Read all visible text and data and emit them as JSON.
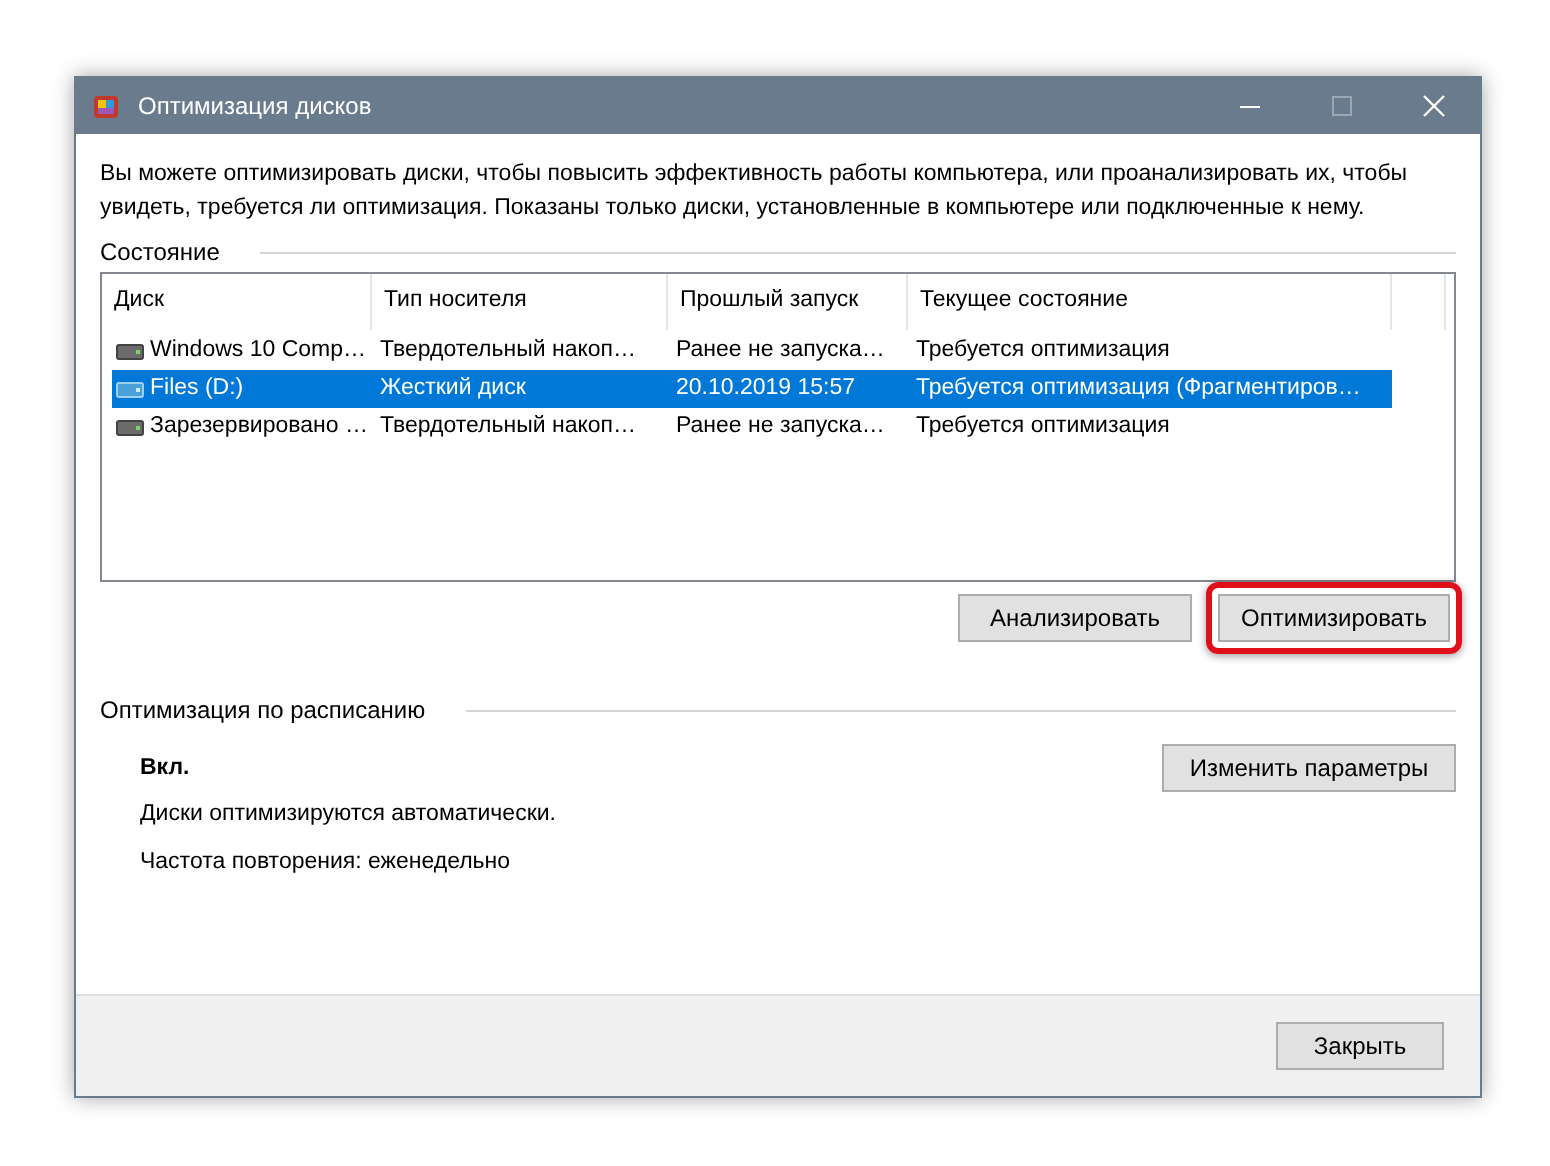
{
  "window": {
    "title": "Оптимизация дисков"
  },
  "description": "Вы можете оптимизировать диски, чтобы повысить эффективность работы  компьютера, или проанализировать их, чтобы увидеть, требуется ли оптимизация. Показаны только диски, установленные в компьютере или подключенные к нему.",
  "status_section": {
    "title": "Состояние"
  },
  "table": {
    "columns": [
      "Диск",
      "Тип носителя",
      "Прошлый запуск",
      "Текущее состояние"
    ],
    "rows": [
      {
        "cells": [
          "Windows 10 Comp…",
          "Твердотельный накоп…",
          "Ранее не запуска…",
          "Требуется оптимизация"
        ],
        "selected": false
      },
      {
        "cells": [
          "Files (D:)",
          "Жесткий диск",
          "20.10.2019 15:57",
          "Требуется оптимизация (Фрагментиров…"
        ],
        "selected": true
      },
      {
        "cells": [
          "Зарезервировано …",
          "Твердотельный накоп…",
          "Ранее не запуска…",
          "Требуется оптимизация"
        ],
        "selected": false
      }
    ]
  },
  "actions": [
    {
      "label": "Анализировать",
      "highlighted": false
    },
    {
      "label": "Оптимизировать",
      "highlighted": true
    }
  ],
  "schedule": {
    "title": "Оптимизация по расписанию",
    "state": "Вкл.",
    "lines": [
      "Диски оптимизируются автоматически.",
      "Частота повторения: еженедельно"
    ],
    "button": "Изменить параметры"
  },
  "footer": {
    "button": "Закрыть"
  }
}
